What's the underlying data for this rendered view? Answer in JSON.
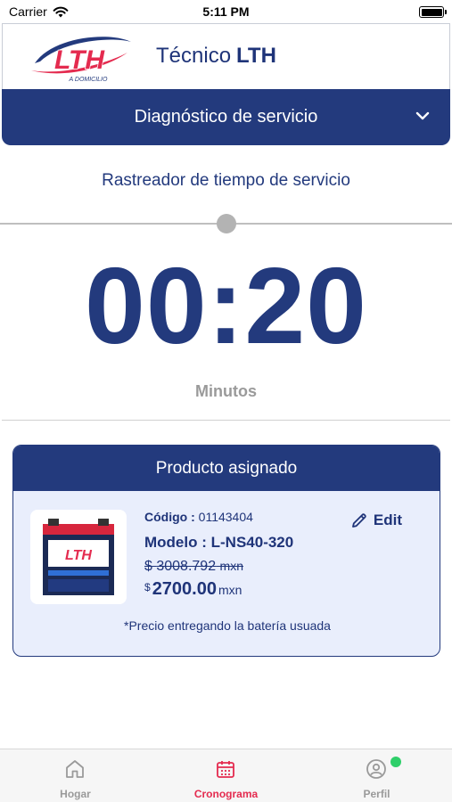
{
  "status": {
    "carrier": "Carrier",
    "time": "5:11 PM"
  },
  "header": {
    "title_prefix": "Técnico",
    "title_brand": "LTH",
    "logo_text": "LTH",
    "logo_sub": "A DOMICILIO"
  },
  "banner": {
    "title": "Diagnóstico de servicio"
  },
  "tracker": {
    "label": "Rastreador de tiempo de servicio",
    "progress": 0.5,
    "time": "00:20",
    "unit": "Minutos"
  },
  "product": {
    "header": "Producto asignado",
    "code_label": "Código :",
    "code_value": "01143404",
    "model_label": "Modelo :",
    "model_value": "L-NS40-320",
    "old_price_symbol": "$",
    "old_price": "3008.792",
    "old_price_unit": "mxn",
    "price_symbol": "$",
    "price": "2700.00",
    "price_unit": "mxn",
    "edit_label": "Edit",
    "note": "*Precio entregando la batería usuada",
    "image_brand": "LTH"
  },
  "tabs": [
    {
      "label": "Hogar",
      "icon": "home-icon",
      "active": false
    },
    {
      "label": "Cronograma",
      "icon": "calendar-icon",
      "active": true
    },
    {
      "label": "Perfil",
      "icon": "profile-icon",
      "active": false
    }
  ],
  "colors": {
    "primary": "#233a7d",
    "accent": "#e42b4f",
    "notification": "#2fcf6a",
    "card_bg": "#e9eefc"
  }
}
